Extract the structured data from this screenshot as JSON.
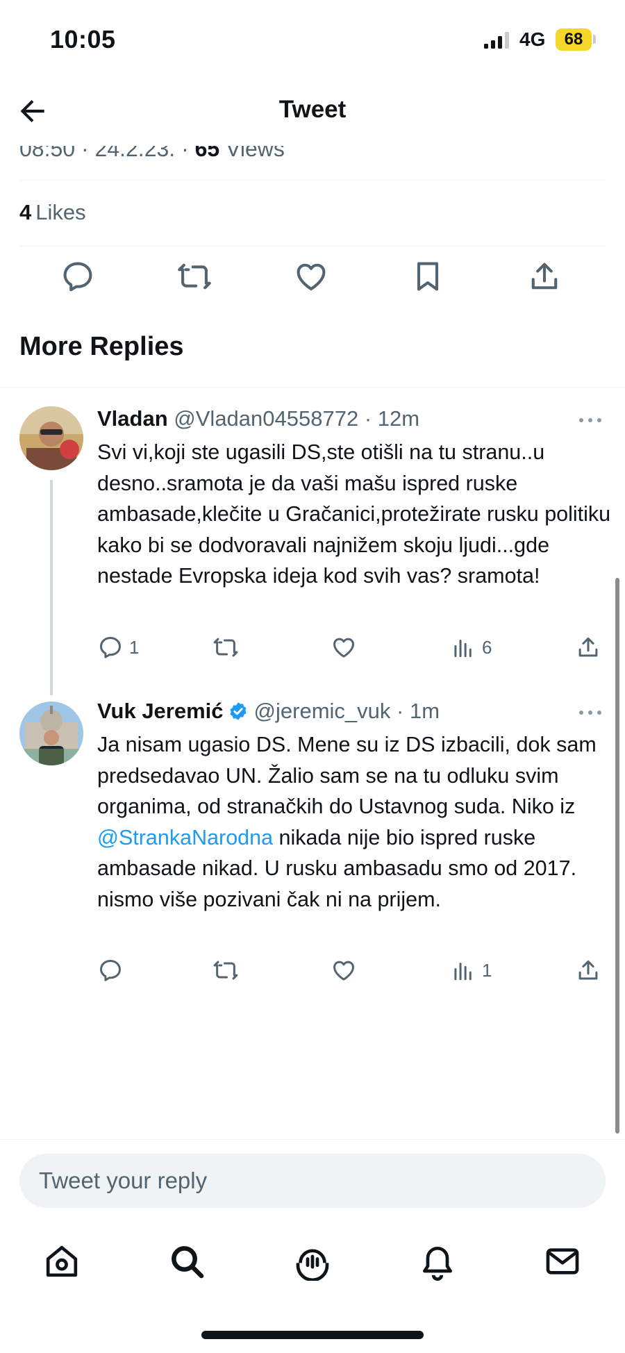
{
  "status": {
    "time": "10:05",
    "network": "4G",
    "battery": "68"
  },
  "header": {
    "title": "Tweet"
  },
  "tweet": {
    "meta_partial_prefix": "08:50 · 24.2.23. · ",
    "meta_partial_views_count": "65",
    "meta_partial_views_label": " Views",
    "likes_count": "4",
    "likes_label": "Likes",
    "action_icons": [
      "reply-icon",
      "retweet-icon",
      "like-icon",
      "bookmark-icon",
      "share-icon"
    ]
  },
  "section": {
    "title": "More Replies"
  },
  "replies": [
    {
      "name": "Vladan",
      "handle": "@Vladan04558772",
      "time": "· 12m",
      "text": "Svi vi,koji ste ugasili DS,ste otišli na tu stranu..u desno..sramota je da vaši mašu ispred ruske ambasade,klečite u Gračanici,protežirate rusku politiku kako bi se dodvoravali najnižem skoju ljudi...gde nestade Evropska ideja kod svih vas? sramota!",
      "reply_count": "1",
      "views_count": "6"
    },
    {
      "name": "Vuk Jeremić",
      "handle": "@jeremic_vuk",
      "time": "· 1m",
      "verified": true,
      "text_before": "Ja nisam ugasio DS. Mene su iz DS izbacili, dok sam predsedavao UN. Žalio sam se na tu odluku svim organima, od stranačkih do Ustavnog suda. Niko iz ",
      "mention": "@StrankaNarodna",
      "text_after": " nikada nije bio ispred ruske ambasade nikad. U rusku ambasadu smo od 2017. nismo više pozivani čak ni na prijem.",
      "views_count": "1"
    }
  ],
  "composer": {
    "placeholder": "Tweet your reply"
  },
  "tabs": [
    "home-icon",
    "search-icon",
    "spaces-icon",
    "notifications-icon",
    "messages-icon"
  ],
  "colors": {
    "accent": "#1d9bf0",
    "text": "#0f1419",
    "muted": "#536471",
    "verified": "#1d9bf0",
    "battery": "#f5d72a"
  }
}
